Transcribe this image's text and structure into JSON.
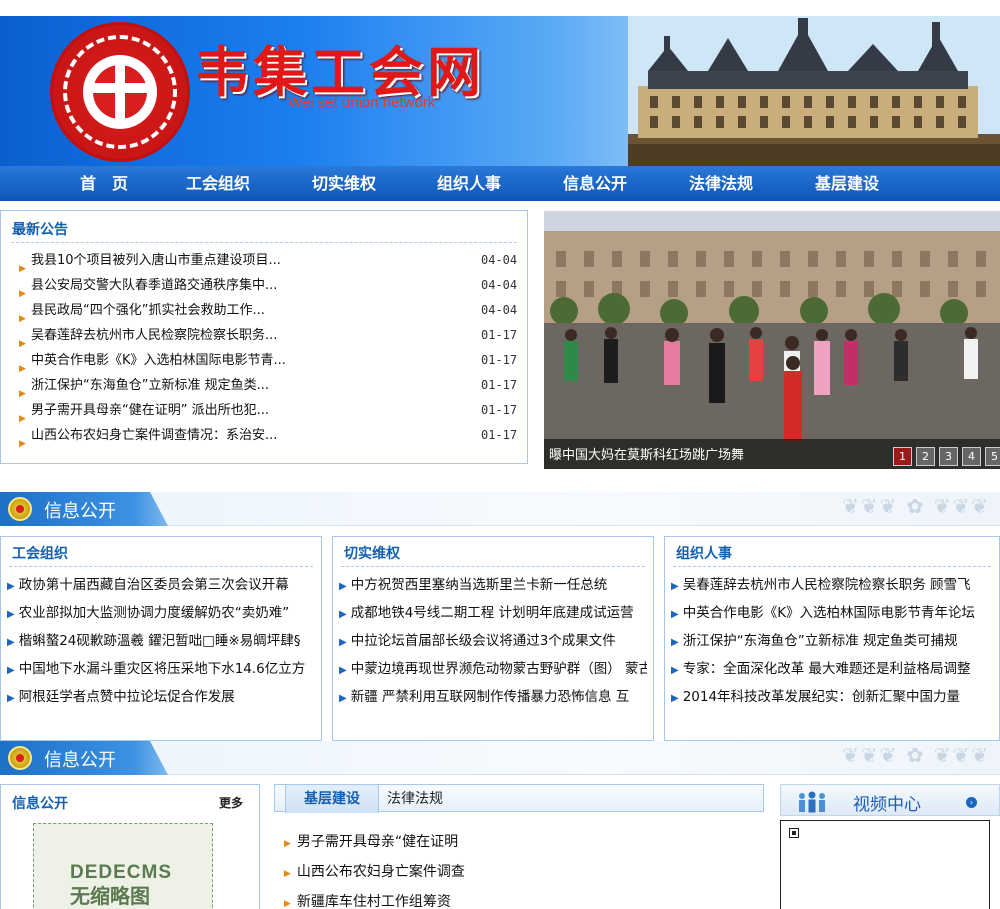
{
  "header": {
    "title": "韦集工会网",
    "subtitle": "Wei set union network"
  },
  "nav": {
    "items": [
      "首　页",
      "工会组织",
      "切实维权",
      "组织人事",
      "信息公开",
      "法律法规",
      "基层建设"
    ]
  },
  "notice": {
    "title": "最新公告",
    "items": [
      {
        "text": "我县10个项目被列入唐山市重点建设项目...",
        "date": "04-04"
      },
      {
        "text": "县公安局交警大队春季道路交通秩序集中...",
        "date": "04-04"
      },
      {
        "text": "县民政局“四个强化”抓实社会救助工作...",
        "date": "04-04"
      },
      {
        "text": "吴春莲辞去杭州市人民检察院检察长职务...",
        "date": "01-17"
      },
      {
        "text": "中英合作电影《K》入选柏林国际电影节青...",
        "date": "01-17"
      },
      {
        "text": "浙江保护“东海鱼仓”立新标准 规定鱼类...",
        "date": "01-17"
      },
      {
        "text": "男子需开具母亲“健在证明” 派出所也犯...",
        "date": "01-17"
      },
      {
        "text": "山西公布农妇身亡案件调查情况：系治安...",
        "date": "01-17"
      }
    ]
  },
  "slideshow": {
    "caption": "曝中国大妈在莫斯科红场跳广场舞",
    "pages": [
      "1",
      "2",
      "3",
      "4",
      "5"
    ],
    "active_page": 1
  },
  "section1": {
    "label": "信息公开"
  },
  "section2": {
    "label": "信息公开"
  },
  "columns": [
    {
      "title": "工会组织",
      "items": [
        "政协第十届西藏自治区委员会第三次会议开幕",
        "农业部拟加大监测协调力度缓解奶农“卖奶难”",
        "楷蝌螯24砚歉跡溫羲 鑃汜暂咄□睡※易皗坪肆§",
        "中国地下水漏斗重灾区将压采地下水14.6亿立方",
        "阿根廷学者点赞中拉论坛促合作发展"
      ]
    },
    {
      "title": "切实维权",
      "items": [
        "中方祝贺西里塞纳当选斯里兰卡新一任总统",
        "成都地铁4号线二期工程 计划明年底建成试运营",
        "中拉论坛首届部长级会议将通过3个成果文件",
        "中蒙边境再现世界濒危动物蒙古野驴群（图） 蒙古",
        "新疆 严禁利用互联网制作传播暴力恐怖信息 互"
      ]
    },
    {
      "title": "组织人事",
      "items": [
        "吴春莲辞去杭州市人民检察院检察长职务 顾雪飞",
        "中英合作电影《K》入选柏林国际电影节青年论坛",
        "浙江保护“东海鱼仓”立新标准 规定鱼类可捕规",
        "专家：全面深化改革 最大难题还是利益格局调整",
        "2014年科技改革发展纪实：创新汇聚中国力量"
      ]
    }
  ],
  "info_box": {
    "title": "信息公开",
    "more": "更多",
    "thumb_line1": "DEDECMS",
    "thumb_line2": "无缩略图"
  },
  "tabs": {
    "active": "基层建设",
    "other": "法律法规"
  },
  "tab_list": [
    "男子需开具母亲“健在证明",
    "山西公布农妇身亡案件调查",
    "新疆库车住村工作组筹资"
  ],
  "video": {
    "title": "视频中心"
  },
  "colors": {
    "accent": "#1560b0",
    "nav_bg": "#0d56b8",
    "arrow": "#e38a12",
    "title_red": "#e01818"
  }
}
